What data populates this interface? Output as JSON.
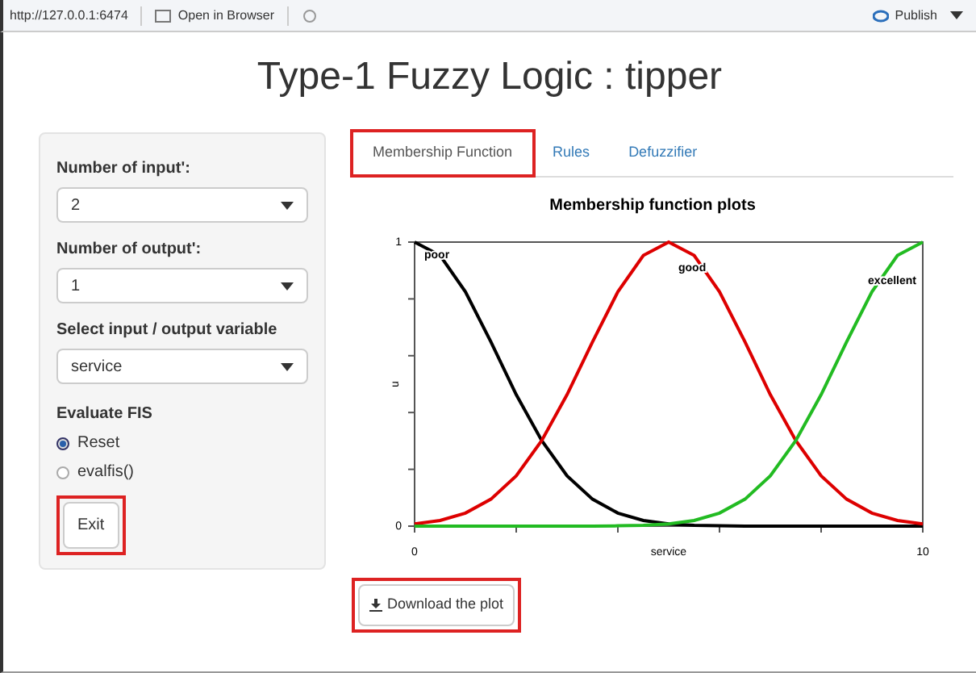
{
  "toolbar": {
    "url": "http://127.0.0.1:6474",
    "open_in_browser": "Open in Browser",
    "publish": "Publish"
  },
  "title": "Type-1 Fuzzy Logic : tipper",
  "sidebar": {
    "fields": [
      {
        "label": "Number of input':",
        "value": "2"
      },
      {
        "label": "Number of output':",
        "value": "1"
      },
      {
        "label": "Select input / output variable",
        "value": "service"
      }
    ],
    "evaluate": {
      "label": "Evaluate FIS",
      "options": [
        {
          "label": "Reset",
          "selected": true
        },
        {
          "label": "evalfis()",
          "selected": false
        }
      ]
    },
    "exit": {
      "label": "Exit",
      "highlighted": true
    }
  },
  "tabs": [
    {
      "label": "Membership Function",
      "selected": true,
      "highlighted": true
    },
    {
      "label": "Rules",
      "selected": false,
      "highlighted": false
    },
    {
      "label": "Defuzzifier",
      "selected": false,
      "highlighted": false
    }
  ],
  "plot": {
    "chart_data": {
      "type": "line",
      "title": "Membership function plots",
      "xlabel": "service",
      "ylabel": "u",
      "x": [
        0,
        0.5,
        1,
        1.5,
        2,
        2.5,
        3,
        3.5,
        4,
        4.5,
        5,
        5.5,
        6,
        6.5,
        7,
        7.5,
        8,
        8.5,
        9,
        9.5,
        10
      ],
      "xlim": [
        0,
        10
      ],
      "ylim": [
        0,
        1
      ],
      "xticks": [
        0,
        10
      ],
      "yticks": [
        0,
        1
      ],
      "series": [
        {
          "name": "poor",
          "color": "#000000",
          "values": [
            1,
            0.953,
            0.825,
            0.649,
            0.463,
            0.301,
            0.177,
            0.095,
            0.046,
            0.02,
            0.008,
            0.003,
            0.001,
            0,
            0,
            0,
            0,
            0,
            0,
            0,
            0
          ]
        },
        {
          "name": "good",
          "color": "#dd0000",
          "values": [
            0.008,
            0.02,
            0.046,
            0.095,
            0.177,
            0.301,
            0.463,
            0.649,
            0.825,
            0.953,
            1,
            0.953,
            0.825,
            0.649,
            0.463,
            0.301,
            0.177,
            0.095,
            0.046,
            0.02,
            0.008
          ]
        },
        {
          "name": "excellent",
          "color": "#22bb22",
          "values": [
            0,
            0,
            0,
            0,
            0,
            0,
            0,
            0,
            0.001,
            0.003,
            0.008,
            0.02,
            0.046,
            0.095,
            0.177,
            0.301,
            0.463,
            0.649,
            0.825,
            0.953,
            1
          ]
        }
      ]
    },
    "download": {
      "label": "Download the plot",
      "highlighted": true
    }
  }
}
